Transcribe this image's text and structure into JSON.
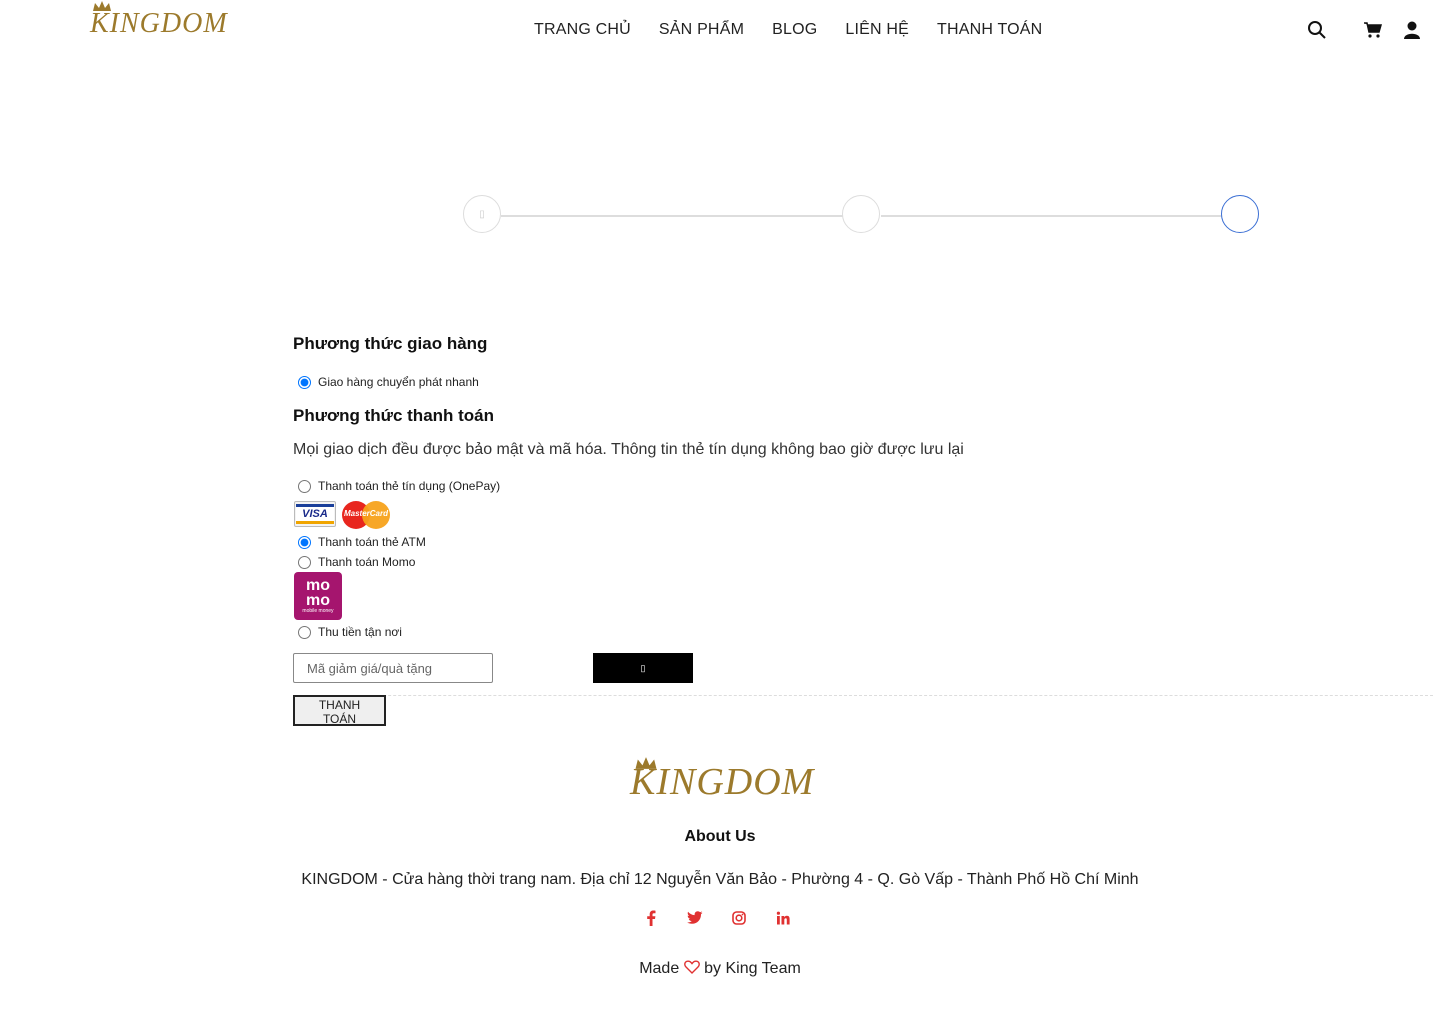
{
  "header": {
    "logo": "KINGDOM",
    "nav": [
      "TRANG CHỦ",
      "SẢN PHẨM",
      "BLOG",
      "LIÊN HỆ",
      "THANH TOÁN"
    ],
    "icons": [
      "search-icon",
      "cart-icon",
      "user-icon"
    ]
  },
  "stepper": {
    "steps": 3,
    "active_step": 3,
    "step1_glyph": "▯"
  },
  "shipping": {
    "heading": "Phương thức giao hàng",
    "option": "Giao hàng chuyển phát nhanh"
  },
  "payment": {
    "heading": "Phương thức thanh toán",
    "note": "Mọi giao dịch đều được bảo mật và mã hóa. Thông tin thẻ tín dụng không bao giờ được lưu lại",
    "options": [
      "Thanh toán thẻ tín dụng (OnePay)",
      "Thanh toán thẻ ATM",
      "Thanh toán Momo",
      "Thu tiền tận nơi"
    ],
    "selected": "Thanh toán thẻ ATM",
    "visa_label": "VISA",
    "mastercard_label": "MasterCard",
    "momo_label_top": "mo",
    "momo_label_bottom": "mo",
    "momo_small": "mobile money"
  },
  "coupon": {
    "placeholder": "Mã giảm giá/quà tặng",
    "apply_glyph": "▯"
  },
  "checkout_button": "THANH TOÁN",
  "footer": {
    "logo": "KINGDOM",
    "about_heading": "About Us",
    "address": "KINGDOM - Cửa hàng thời trang nam. Địa chỉ 12 Nguyễn Văn Bảo - Phường 4 - Q. Gò Vấp - Thành Phố Hồ Chí Minh",
    "social": [
      "facebook-icon",
      "twitter-icon",
      "instagram-icon",
      "linkedin-icon"
    ],
    "made_prefix": "Made",
    "made_suffix": "by King Team"
  },
  "colors": {
    "brand_gold": "#9c7a2c",
    "accent_blue": "#3b6fd4",
    "social_red": "#e03131"
  }
}
